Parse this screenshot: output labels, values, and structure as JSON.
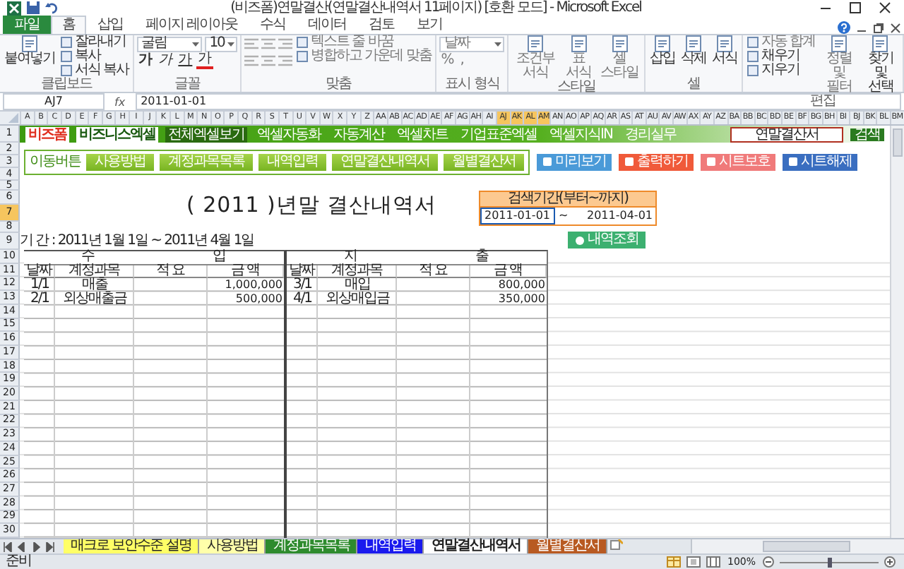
{
  "window": {
    "title": "(비즈폼)연말결산(연말결산내역서 11페이지) [호환 모드] - Microsoft Excel"
  },
  "ribbon_tabs": [
    {
      "label": "파일",
      "kind": "file",
      "selected": false
    },
    {
      "label": "홈",
      "kind": "tab",
      "selected": true
    },
    {
      "label": "삽입",
      "kind": "tab",
      "selected": false
    },
    {
      "label": "페이지 레이아웃",
      "kind": "tab",
      "selected": false
    },
    {
      "label": "수식",
      "kind": "tab",
      "selected": false
    },
    {
      "label": "데이터",
      "kind": "tab",
      "selected": false
    },
    {
      "label": "검토",
      "kind": "tab",
      "selected": false
    },
    {
      "label": "보기",
      "kind": "tab",
      "selected": false
    }
  ],
  "ribbon_groups": [
    {
      "label": "클립보드",
      "columns": [
        [
          {
            "kind": "big",
            "label": "붙여넣기",
            "disabled": false
          }
        ],
        [
          {
            "kind": "small",
            "label": "잘라내기",
            "disabled": false
          },
          {
            "kind": "small",
            "label": "복사",
            "disabled": false
          },
          {
            "kind": "small",
            "label": "서식 복사",
            "disabled": false
          }
        ]
      ]
    },
    {
      "label": "글꼴",
      "columns": [
        [
          {
            "kind": "selects",
            "values": [
              "굴림",
              "10"
            ],
            "disabled": false
          },
          {
            "kind": "glyphs",
            "disabled": false,
            "chars": [
              "가",
              "가",
              "가",
              "가"
            ]
          }
        ]
      ]
    },
    {
      "label": "맞춤",
      "columns": [
        [
          {
            "kind": "icons",
            "disabled": true
          },
          {
            "kind": "icons",
            "disabled": true
          }
        ],
        [
          {
            "kind": "small",
            "label": "텍스트 줄 바꿈",
            "disabled": true
          },
          {
            "kind": "small",
            "label": "병합하고 가운데 맞춤",
            "disabled": true
          }
        ]
      ]
    },
    {
      "label": "표시 형식",
      "columns": [
        [
          {
            "kind": "selects",
            "values": [
              "날짜"
            ],
            "disabled": true
          },
          {
            "kind": "glyphs",
            "disabled": true,
            "chars": [
              "%",
              ","
            ]
          }
        ]
      ]
    },
    {
      "label": "스타일",
      "columns": [
        [
          {
            "kind": "big",
            "label": "조건부 서식",
            "disabled": true
          }
        ],
        [
          {
            "kind": "big",
            "label": "표 서식",
            "disabled": true
          }
        ],
        [
          {
            "kind": "big",
            "label": "셀 스타일",
            "disabled": true
          }
        ]
      ]
    },
    {
      "label": "셀",
      "columns": [
        [
          {
            "kind": "big",
            "label": "삽입",
            "disabled": false
          }
        ],
        [
          {
            "kind": "big",
            "label": "삭제",
            "disabled": false
          }
        ],
        [
          {
            "kind": "big",
            "label": "서식",
            "disabled": false
          }
        ]
      ]
    },
    {
      "label": "편집",
      "columns": [
        [
          {
            "kind": "small",
            "label": "자동 합계",
            "disabled": true
          },
          {
            "kind": "small",
            "label": "채우기",
            "disabled": false
          },
          {
            "kind": "small",
            "label": "지우기",
            "disabled": false
          }
        ],
        [
          {
            "kind": "big",
            "label": "정렬 및 필터",
            "disabled": true
          }
        ],
        [
          {
            "kind": "big",
            "label": "찾기 및 선택",
            "disabled": false
          }
        ]
      ]
    }
  ],
  "formula_bar": {
    "name_box": "AJ7",
    "fx": "fx",
    "value": "2011-01-01"
  },
  "columns": [
    {
      "label": "A",
      "selected": false
    },
    {
      "label": "B",
      "selected": false
    },
    {
      "label": "C",
      "selected": false
    },
    {
      "label": "D",
      "selected": false
    },
    {
      "label": "E",
      "selected": false
    },
    {
      "label": "F",
      "selected": false
    },
    {
      "label": "G",
      "selected": false
    },
    {
      "label": "H",
      "selected": false
    },
    {
      "label": "I",
      "selected": false
    },
    {
      "label": "J",
      "selected": false
    },
    {
      "label": "K",
      "selected": false
    },
    {
      "label": "L",
      "selected": false
    },
    {
      "label": "M",
      "selected": false
    },
    {
      "label": "N",
      "selected": false
    },
    {
      "label": "O",
      "selected": false
    },
    {
      "label": "P",
      "selected": false
    },
    {
      "label": "Q",
      "selected": false
    },
    {
      "label": "R",
      "selected": false
    },
    {
      "label": "S",
      "selected": false
    },
    {
      "label": "T",
      "selected": false
    },
    {
      "label": "U",
      "selected": false
    },
    {
      "label": "V",
      "selected": false
    },
    {
      "label": "W",
      "selected": false
    },
    {
      "label": "X",
      "selected": false
    },
    {
      "label": "Y",
      "selected": false
    },
    {
      "label": "Z",
      "selected": false
    },
    {
      "label": "AA",
      "selected": false
    },
    {
      "label": "AB",
      "selected": false
    },
    {
      "label": "AC",
      "selected": false
    },
    {
      "label": "AD",
      "selected": false
    },
    {
      "label": "AE",
      "selected": false
    },
    {
      "label": "AF",
      "selected": false
    },
    {
      "label": "AG",
      "selected": false
    },
    {
      "label": "AH",
      "selected": false
    },
    {
      "label": "AI",
      "selected": false
    },
    {
      "label": "AJ",
      "selected": true
    },
    {
      "label": "AK",
      "selected": true
    },
    {
      "label": "AL",
      "selected": true
    },
    {
      "label": "AM",
      "selected": true
    },
    {
      "label": "AN",
      "selected": false
    },
    {
      "label": "AO",
      "selected": false
    },
    {
      "label": "AP",
      "selected": false
    },
    {
      "label": "AQ",
      "selected": false
    },
    {
      "label": "AR",
      "selected": false
    },
    {
      "label": "AS",
      "selected": false
    },
    {
      "label": "AT",
      "selected": false
    },
    {
      "label": "AU",
      "selected": false
    },
    {
      "label": "AV",
      "selected": false
    },
    {
      "label": "AW",
      "selected": false
    },
    {
      "label": "AX",
      "selected": false
    },
    {
      "label": "AY",
      "selected": false
    },
    {
      "label": "AZ",
      "selected": false
    },
    {
      "label": "BA",
      "selected": false
    },
    {
      "label": "BB",
      "selected": false
    },
    {
      "label": "BC",
      "selected": false
    },
    {
      "label": "BD",
      "selected": false
    },
    {
      "label": "BE",
      "selected": false
    },
    {
      "label": "BF",
      "selected": false
    },
    {
      "label": "BG",
      "selected": false
    },
    {
      "label": "BH",
      "selected": false
    },
    {
      "label": "BI",
      "selected": false
    },
    {
      "label": "BJ",
      "selected": false
    },
    {
      "label": "BK",
      "selected": false
    },
    {
      "label": "BL",
      "selected": false
    },
    {
      "label": "BM",
      "selected": false
    }
  ],
  "rows": [
    {
      "label": "1",
      "selected": false
    },
    {
      "label": "2",
      "selected": false
    },
    {
      "label": "3",
      "selected": false
    },
    {
      "label": "4",
      "selected": false
    },
    {
      "label": "5",
      "selected": false
    },
    {
      "label": "6",
      "selected": false
    },
    {
      "label": "7",
      "selected": true
    },
    {
      "label": "8",
      "selected": false
    },
    {
      "label": "9",
      "selected": false
    },
    {
      "label": "10",
      "selected": false
    },
    {
      "label": "11",
      "selected": false
    },
    {
      "label": "12",
      "selected": false
    },
    {
      "label": "13",
      "selected": false
    },
    {
      "label": "14",
      "selected": false
    },
    {
      "label": "15",
      "selected": false
    },
    {
      "label": "16",
      "selected": false
    },
    {
      "label": "17",
      "selected": false
    },
    {
      "label": "18",
      "selected": false
    },
    {
      "label": "19",
      "selected": false
    },
    {
      "label": "20",
      "selected": false
    },
    {
      "label": "21",
      "selected": false
    },
    {
      "label": "22",
      "selected": false
    },
    {
      "label": "23",
      "selected": false
    },
    {
      "label": "24",
      "selected": false
    },
    {
      "label": "25",
      "selected": false
    },
    {
      "label": "26",
      "selected": false
    },
    {
      "label": "27",
      "selected": false
    },
    {
      "label": "28",
      "selected": false
    },
    {
      "label": "29",
      "selected": false
    },
    {
      "label": "30",
      "selected": false
    }
  ],
  "banner": {
    "logo_mark": "비즈폼",
    "logo_text": "비즈니스엑셀",
    "menu": [
      {
        "label": "전체엑셀보기",
        "selected": true
      },
      {
        "label": "엑셀자동화",
        "selected": false
      },
      {
        "label": "자동계산",
        "selected": false
      },
      {
        "label": "엑셀차트",
        "selected": false
      },
      {
        "label": "기업표준엑셀",
        "selected": false
      },
      {
        "label": "엑셀지식IN",
        "selected": false
      },
      {
        "label": "경리실무",
        "selected": false
      }
    ],
    "search": {
      "value": "연말결산서"
    },
    "search_button": "검색"
  },
  "nav_panel": {
    "label": "이동버튼",
    "buttons": [
      "사용방법",
      "계정과목목록",
      "내역입력",
      "연말결산내역서",
      "월별결산서"
    ]
  },
  "tool_buttons": [
    {
      "label": "미리보기",
      "color": "#4a9ad8"
    },
    {
      "label": "출력하기",
      "color": "#f05a3a"
    },
    {
      "label": "시트보호",
      "color": "#f07a7a"
    },
    {
      "label": "시트해제",
      "color": "#3a6ec0"
    }
  ],
  "report": {
    "title": "( 2011 )년말 결산내역서",
    "period": "기 간 : 2011년 1월 1일 ~ 2011년 4월 1일",
    "sections": [
      {
        "heading": "수 입",
        "columns": [
          "날짜",
          "계정과목",
          "적 요",
          "금 액"
        ],
        "rows": [
          {
            "date": "1/1",
            "account": "매출",
            "amount": "1,000,000"
          },
          {
            "date": "2/1",
            "account": "외상매출금",
            "amount": "500,000"
          }
        ]
      },
      {
        "heading": "지 출",
        "columns": [
          "날짜",
          "계정과목",
          "적 요",
          "금 액"
        ],
        "rows": [
          {
            "date": "3/1",
            "account": "매입",
            "amount": "800,000"
          },
          {
            "date": "4/1",
            "account": "외상매입금",
            "amount": "350,000"
          }
        ]
      }
    ]
  },
  "search_panel": {
    "heading": "검색기간(부터~까지)",
    "from": "2011-01-01",
    "separator": "~",
    "to": "2011-04-01",
    "button": "내역조회"
  },
  "sheet_tabs": [
    {
      "label": "매크로 보안수준 설명",
      "color": "#ffff66",
      "selected": false
    },
    {
      "label": "사용방법",
      "color": "#ffffaa",
      "selected": false
    },
    {
      "label": "계정과목목록",
      "color": "#2e8b2e",
      "selected": false
    },
    {
      "label": "내역입력",
      "color": "#1a1aee",
      "selected": false
    },
    {
      "label": "연말결산내역서",
      "color": "#ffffff",
      "selected": true
    },
    {
      "label": "월별결산서",
      "color": "#b85a22",
      "selected": false
    }
  ],
  "status_bar": {
    "text": "준비",
    "zoom": "100%",
    "zoom_slider": {
      "level": 0.5
    }
  }
}
